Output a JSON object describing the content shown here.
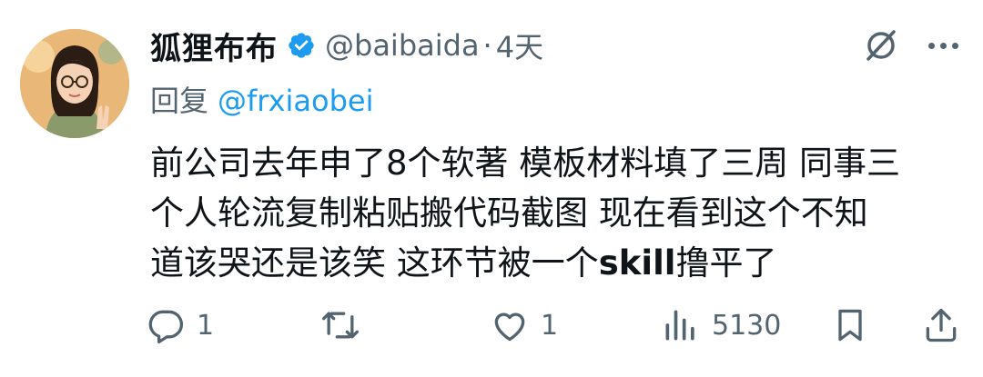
{
  "user": {
    "display_name": "狐狸布布",
    "handle": "@baibaida",
    "separator": "·",
    "time": "4天"
  },
  "reply": {
    "prefix": "回复",
    "to": "@frxiaobei"
  },
  "tweet": {
    "line1": "前公司去年申了8个软著 模板材料填了三周 同事三",
    "line2": "个人轮流复制粘贴搬代码截图 现在看到这个不知",
    "line3_a": "道该哭还是该笑 这环节被一个",
    "line3_bold": "skill",
    "line3_b": "撸平了"
  },
  "actions": {
    "reply_count": "1",
    "like_count": "1",
    "view_count": "5130"
  },
  "colors": {
    "text": "#0f1419",
    "muted": "#536471",
    "link": "#1d9bf0",
    "verified": "#1d9bf0"
  },
  "icons": [
    "grok-icon",
    "more-icon",
    "verified-badge-icon",
    "reply-icon",
    "retweet-icon",
    "like-icon",
    "views-icon",
    "bookmark-icon",
    "share-icon"
  ]
}
